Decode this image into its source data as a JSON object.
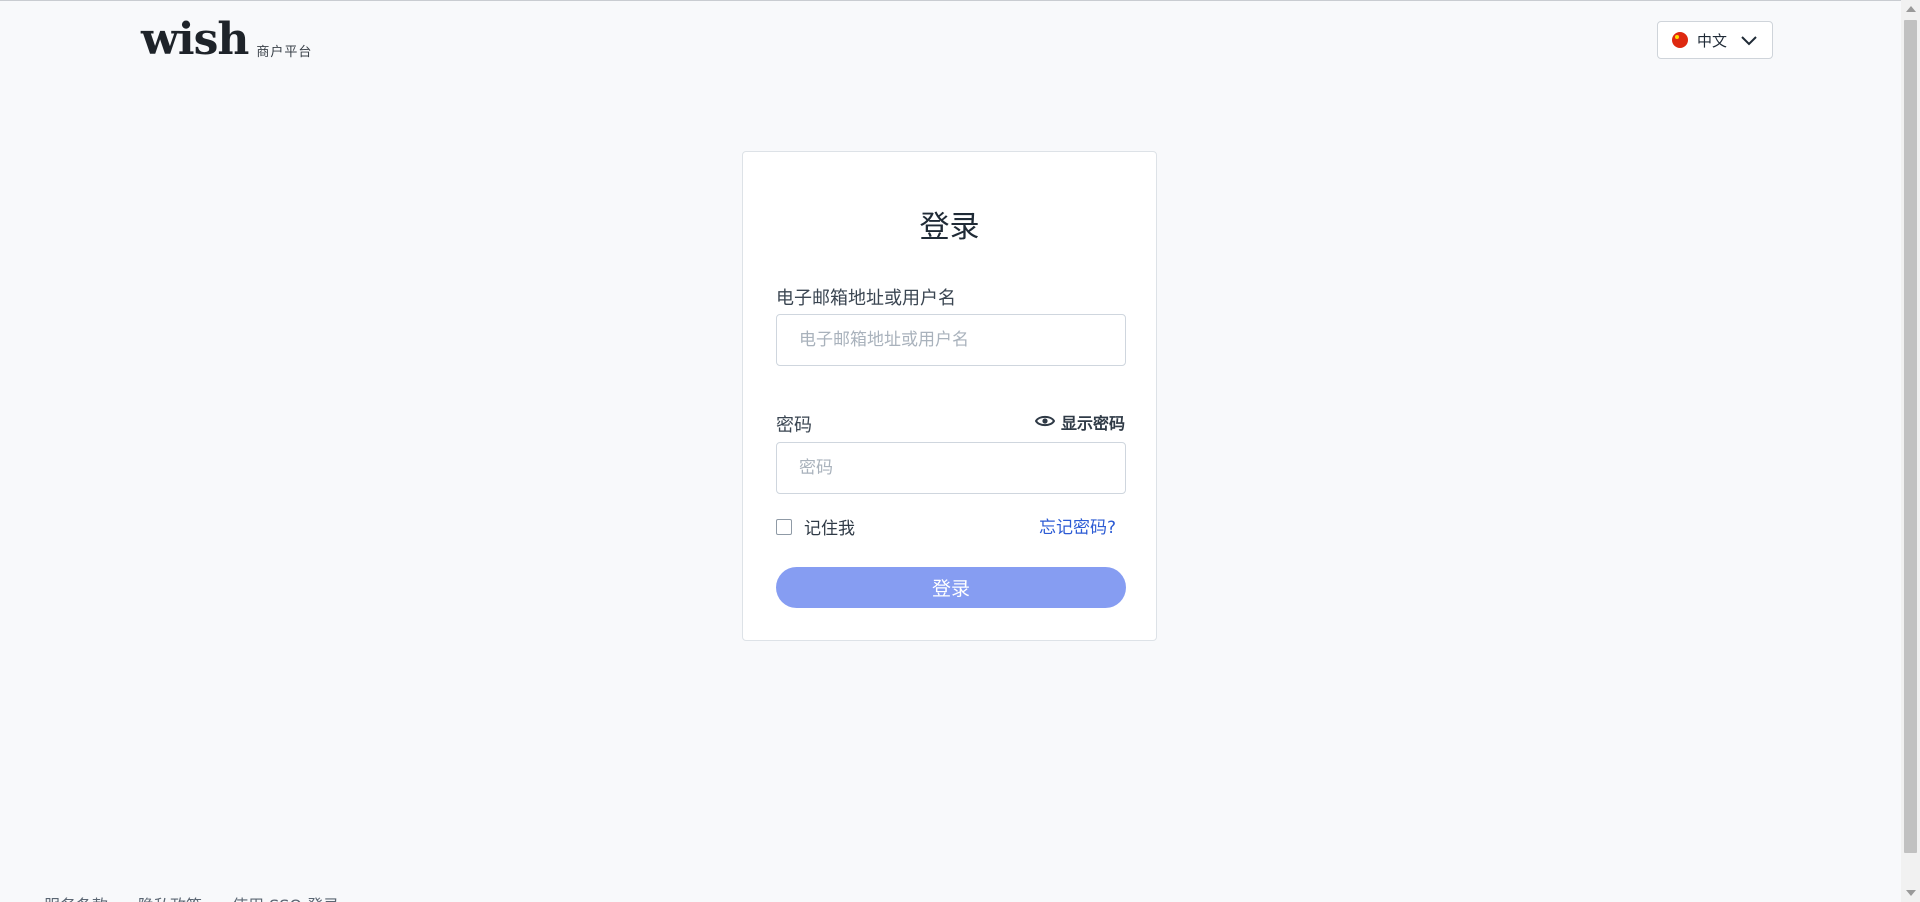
{
  "header": {
    "logo_text": "wish",
    "logo_subtitle": "商户平台",
    "language_label": "中文"
  },
  "login": {
    "title": "登录",
    "email_label": "电子邮箱地址或用户名",
    "email_placeholder": "电子邮箱地址或用户名",
    "email_value": "",
    "password_label": "密码",
    "password_placeholder": "密码",
    "password_value": "",
    "show_password_label": "显示密码",
    "remember_me_label": "记住我",
    "remember_me_checked": false,
    "forgot_password_label": "忘记密码?",
    "submit_label": "登录"
  },
  "footer": {
    "links": [
      "服务条款",
      "隐私政策",
      "使用 SSO 登录"
    ]
  },
  "colors": {
    "accent": "#2c5bd4",
    "button_disabled": "#869df2",
    "flag": "#de2910"
  },
  "icons": {
    "language_flag": "china-flag-icon",
    "dropdown": "chevron-down-icon",
    "show_password": "eye-icon"
  }
}
